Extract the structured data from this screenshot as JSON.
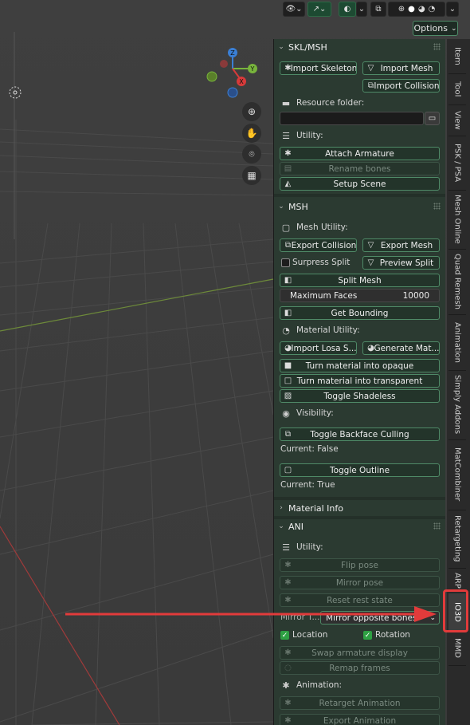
{
  "header": {
    "options_label": "Options"
  },
  "icons": {
    "eye": "eye-icon",
    "gizmo": "gizmo-icon",
    "overlay": "overlay-icon",
    "xray": "xray-toggle-icon",
    "shading_wire": "wireframe-shading-icon",
    "shading_solid": "solid-shading-icon",
    "shading_material": "material-shading-icon",
    "shading_rendered": "rendered-shading-icon"
  },
  "navigation": {
    "axes": [
      "Z",
      "Y",
      "X"
    ]
  },
  "skl_msh": {
    "title": "SKL/MSH",
    "import_skeleton": "Import Skeleton",
    "import_mesh": "Import Mesh",
    "import_collision": "Import Collision",
    "resource_folder_label": "Resource folder:",
    "resource_folder_value": "",
    "utility_label": "Utility:",
    "attach_armature": "Attach Armature",
    "rename_bones": "Rename bones",
    "setup_scene": "Setup Scene"
  },
  "msh": {
    "title": "MSH",
    "mesh_utility_label": "Mesh Utility:",
    "export_collision": "Export Collision",
    "export_mesh": "Export Mesh",
    "surpress_split": "Surpress Split",
    "preview_split": "Preview Split",
    "split_mesh": "Split Mesh",
    "maximum_faces_label": "Maximum Faces",
    "maximum_faces_value": "10000",
    "get_bounding": "Get Bounding",
    "material_utility_label": "Material Utility:",
    "import_losa": "Import Losa S...",
    "generate_mat": "Generate Mat...",
    "turn_opaque": "Turn material into opaque",
    "turn_transparent": "Turn material into transparent",
    "toggle_shadeless": "Toggle Shadeless",
    "visibility_label": "Visibility:",
    "toggle_backface": "Toggle Backface Culling",
    "backface_current": "Current: False",
    "toggle_outline": "Toggle Outline",
    "outline_current": "Current: True"
  },
  "material_info": {
    "title": "Material Info"
  },
  "ani": {
    "title": "ANI",
    "utility_label": "Utility:",
    "flip_pose": "Flip pose",
    "mirror_pose": "Mirror pose",
    "reset_rest_state": "Reset rest state",
    "mirror_label": "Mirror T...",
    "mirror_select_value": "Mirror opposite bones",
    "location_label": "Location",
    "location_checked": true,
    "rotation_label": "Rotation",
    "rotation_checked": true,
    "swap_armature_display": "Swap armature display",
    "remap_frames": "Remap frames",
    "animation_label": "Animation:",
    "retarget_animation": "Retarget Animation",
    "export_animation": "Export Animation"
  },
  "tabs": [
    "Item",
    "Tool",
    "View",
    "PSK / PSA",
    "Mesh Online",
    "Quad Remesh",
    "Animation",
    "Simply Addons",
    "MatCombiner",
    "Retargeting",
    "ARP",
    "IO3D",
    "MMD"
  ],
  "active_tab": "IO3D",
  "highlight_color": "#e23b3b"
}
